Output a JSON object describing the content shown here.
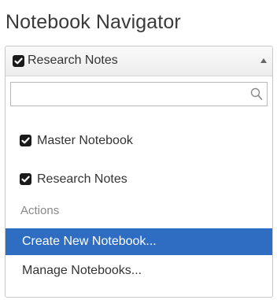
{
  "panel": {
    "title": "Notebook Navigator"
  },
  "selector": {
    "selected_label": "Research Notes",
    "checked": true
  },
  "search": {
    "value": "",
    "placeholder": ""
  },
  "notebooks": [
    {
      "label": "Master Notebook",
      "checked": true
    },
    {
      "label": "Research Notes",
      "checked": true
    }
  ],
  "actions": {
    "group_label": "Actions",
    "items": [
      {
        "label": "Create New Notebook...",
        "highlighted": true
      },
      {
        "label": "Manage Notebooks...",
        "highlighted": false
      }
    ]
  },
  "colors": {
    "highlight": "#2f6dc2",
    "checkbox": "#1a1a1a"
  },
  "icons": {
    "checkbox": "checkmark-icon",
    "caret": "caret-up-icon",
    "search": "search-icon"
  }
}
